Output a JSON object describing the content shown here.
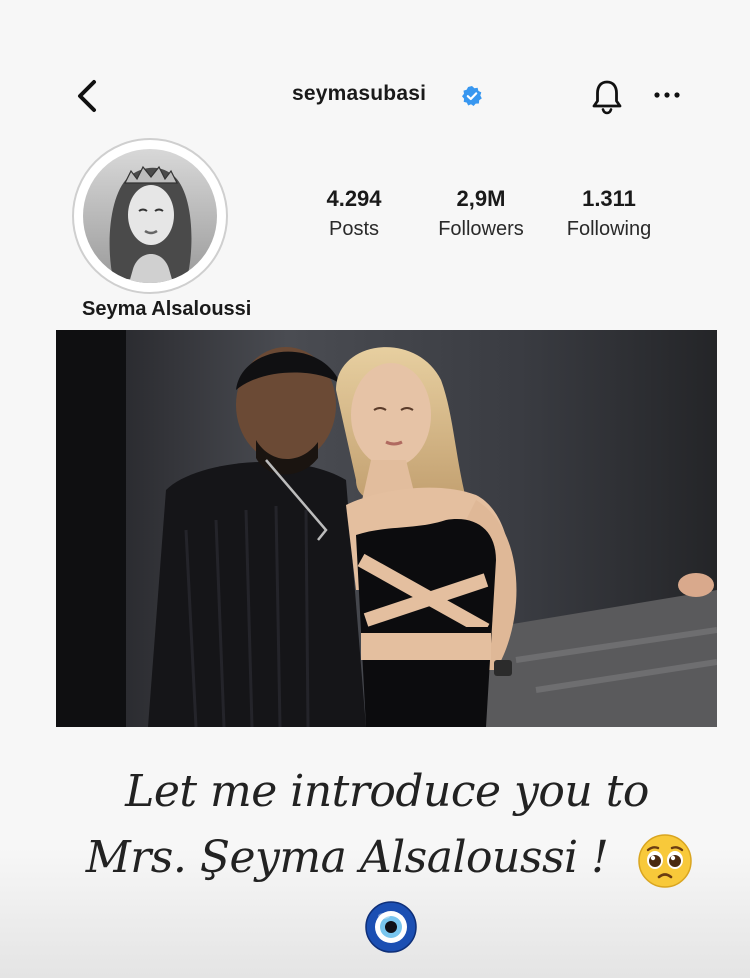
{
  "header": {
    "username": "seymasubasi"
  },
  "profile": {
    "display_name": "Seyma Alsaloussi",
    "stats": [
      {
        "value": "4.294",
        "label": "Posts"
      },
      {
        "value": "2,9M",
        "label": "Followers"
      },
      {
        "value": "1.311",
        "label": "Following"
      }
    ]
  },
  "caption": {
    "line1": "Let me introduce you to",
    "line2": "Mrs. Şeyma Alsaloussi !"
  },
  "icons": {
    "back": "chevron-left-icon",
    "verified": "verified-badge-icon",
    "notifications": "bell-icon",
    "more": "more-horizontal-icon",
    "emoji": "pleading-face-emoji",
    "evil_eye": "nazar-amulet-emoji"
  },
  "colors": {
    "verified_blue": "#3897f0",
    "text": "#1a1a1a"
  }
}
